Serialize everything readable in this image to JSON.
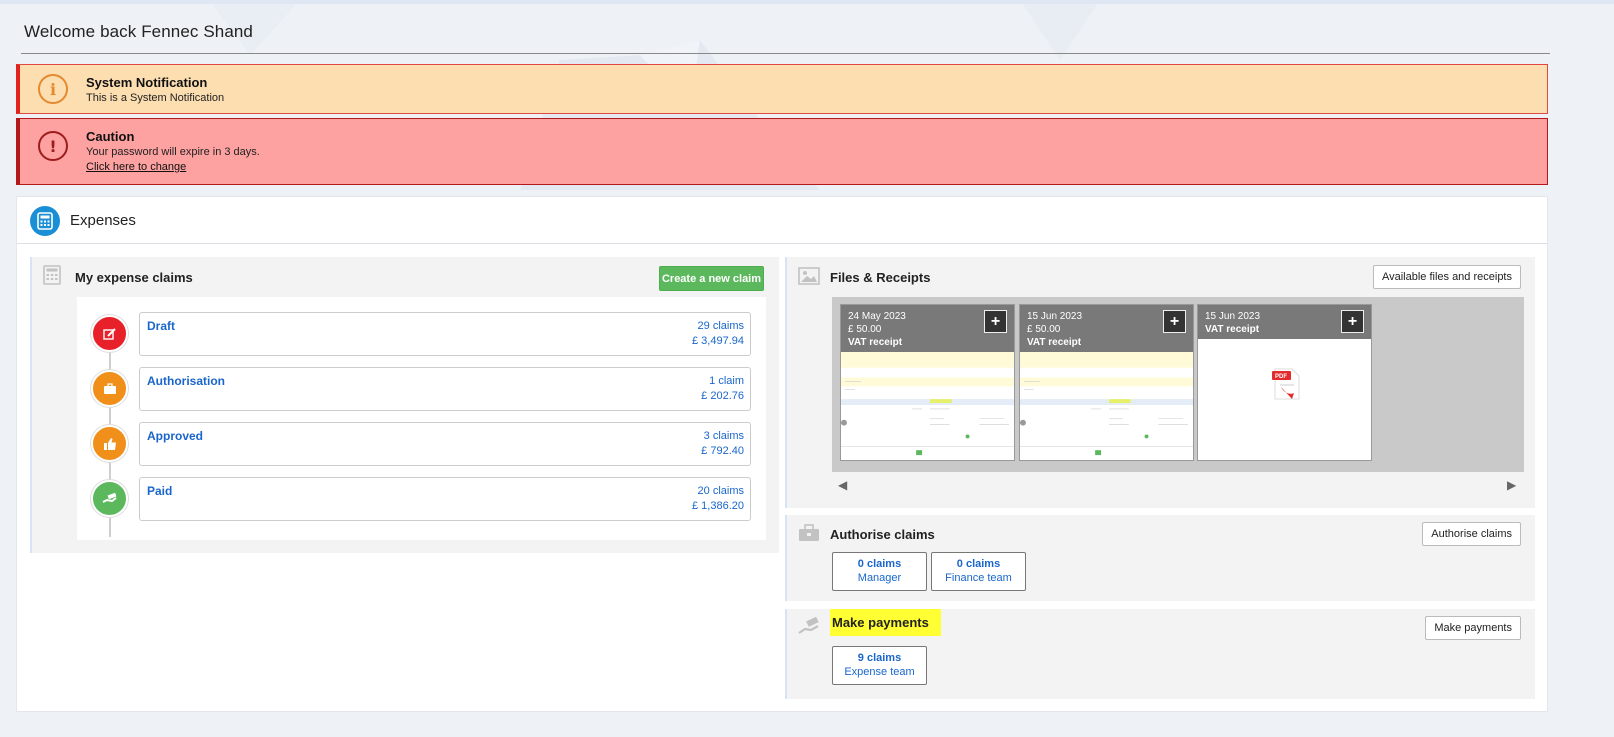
{
  "header": {
    "welcome": "Welcome back Fennec Shand"
  },
  "notifications": {
    "system": {
      "title": "System Notification",
      "text": "This is a System Notification",
      "icon": "info-icon"
    },
    "caution": {
      "title": "Caution",
      "text": "Your password will expire in 3 days.",
      "link": "Click here to change",
      "icon": "exclamation-icon"
    }
  },
  "expenses": {
    "title": "Expenses",
    "my_claims": {
      "title": "My expense claims",
      "create_button": "Create a new claim",
      "items": [
        {
          "name": "Draft",
          "count": "29 claims",
          "amount": "£ 3,497.94",
          "color": "#e8202a",
          "icon": "edit-icon"
        },
        {
          "name": "Authorisation",
          "count": "1 claim",
          "amount": "£ 202.76",
          "color": "#f0901b",
          "icon": "briefcase-icon"
        },
        {
          "name": "Approved",
          "count": "3 claims",
          "amount": "£ 792.40",
          "color": "#f0901b",
          "icon": "thumbs-up-icon"
        },
        {
          "name": "Paid",
          "count": "20 claims",
          "amount": "£ 1,386.20",
          "color": "#5cb85c",
          "icon": "hand-money-icon"
        }
      ]
    },
    "files": {
      "title": "Files & Receipts",
      "button": "Available files and receipts",
      "items": [
        {
          "date": "24 May 2023",
          "amount": "£ 50.00",
          "type": "VAT receipt"
        },
        {
          "date": "15 Jun 2023",
          "amount": "£ 50.00",
          "type": "VAT receipt"
        },
        {
          "date": "15 Jun 2023",
          "amount": "",
          "type": "VAT receipt"
        }
      ]
    },
    "authorise": {
      "title": "Authorise claims",
      "button": "Authorise claims",
      "boxes": [
        {
          "value": "0 claims",
          "label": "Manager"
        },
        {
          "value": "0 claims",
          "label": "Finance team"
        }
      ]
    },
    "payments": {
      "title": "Make payments",
      "button": "Make payments",
      "boxes": [
        {
          "value": "9 claims",
          "label": "Expense team"
        }
      ]
    }
  },
  "colors": {
    "accent": "#1a66cc",
    "success": "#5cb85c",
    "danger": "#e8202a",
    "warning": "#f0901b",
    "highlight": "#ffff33"
  }
}
